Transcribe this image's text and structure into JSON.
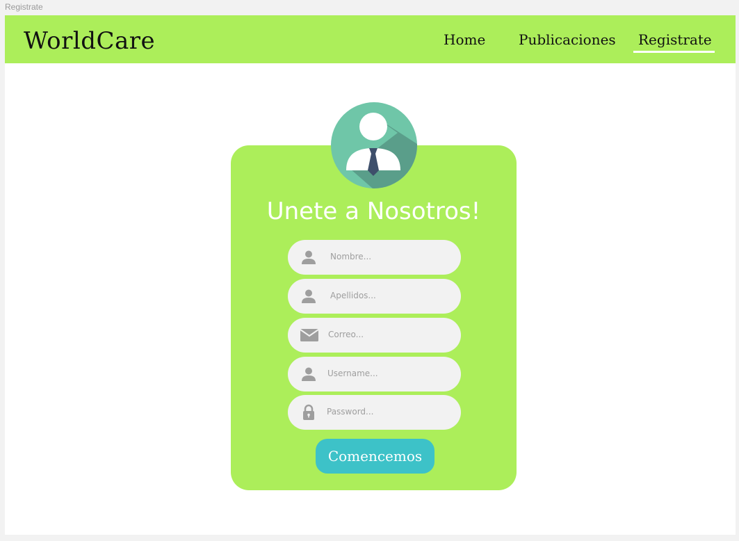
{
  "frame_label": "Registrate",
  "navbar": {
    "brand": "WorldCare",
    "links": [
      {
        "label": "Home",
        "active": false
      },
      {
        "label": "Publicaciones",
        "active": false
      },
      {
        "label": "Registrate",
        "active": true
      }
    ]
  },
  "form": {
    "title": "Unete a Nosotros!",
    "fields": [
      {
        "icon": "person-icon",
        "placeholder": "Nombre..."
      },
      {
        "icon": "person-icon",
        "placeholder": "Apellidos..."
      },
      {
        "icon": "envelope-icon",
        "placeholder": "Correo..."
      },
      {
        "icon": "person-icon",
        "placeholder": "Username..."
      },
      {
        "icon": "lock-icon",
        "placeholder": "Password..."
      }
    ],
    "submit_label": "Comencemos"
  },
  "colors": {
    "accent_green": "#acee5a",
    "button_teal": "#3dc2c8",
    "field_bg": "#f2f2f2",
    "avatar_circle": "#6fc6a8"
  }
}
